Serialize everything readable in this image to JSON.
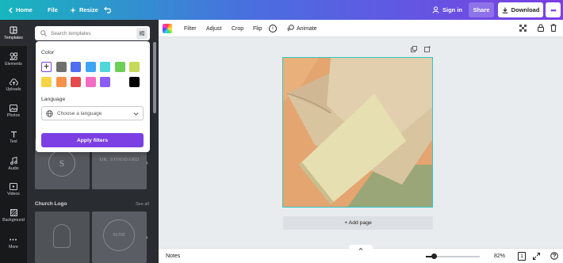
{
  "topbar": {
    "home_label": "Home",
    "file_label": "File",
    "resize_label": "Resize",
    "signin_label": "Sign in",
    "share_label": "Share",
    "download_label": "Download",
    "gradient": [
      "#17b6bd",
      "#4a6ee0",
      "#7b3fe4"
    ]
  },
  "rail": {
    "items": [
      {
        "label": "Templates",
        "icon": "templates-icon",
        "active": true
      },
      {
        "label": "Elements",
        "icon": "elements-icon"
      },
      {
        "label": "Uploads",
        "icon": "upload-cloud-icon"
      },
      {
        "label": "Photos",
        "icon": "photo-icon"
      },
      {
        "label": "Text",
        "icon": "text-icon"
      },
      {
        "label": "Audio",
        "icon": "music-note-icon"
      },
      {
        "label": "Videos",
        "icon": "video-icon"
      },
      {
        "label": "Background",
        "icon": "background-icon"
      },
      {
        "label": "More",
        "icon": "more-dots-icon"
      }
    ]
  },
  "panel": {
    "search_placeholder": "Search templates",
    "section2_title": "Church Logo",
    "see_all": "See all",
    "card_texts": [
      "S",
      "DR. STODDARD",
      "SUNE"
    ]
  },
  "filter_popover": {
    "color_label": "Color",
    "swatches_row1": [
      "add",
      "#6f6f6f",
      "#4f6ef2",
      "#3ea5f2",
      "#4fd7d9",
      "#6ccf57",
      "#c6d95a"
    ],
    "swatches_row2": [
      "#f5d547",
      "#f5924a",
      "#e64b4b",
      "#f36bc3",
      "#8b5cf6",
      "#ffffff",
      "#000000"
    ],
    "language_label": "Language",
    "language_placeholder": "Choose a language",
    "apply_label": "Apply filters"
  },
  "toolbar": {
    "filter_label": "Filter",
    "adjust_label": "Adjust",
    "crop_label": "Crop",
    "flip_label": "Flip",
    "info_label": "i",
    "animate_label": "Animate"
  },
  "canvas": {
    "add_page_label": "+ Add page"
  },
  "bottombar": {
    "notes_label": "Notes",
    "zoom_label": "82%",
    "zoom_fraction": 0.16,
    "page_number": "1"
  }
}
